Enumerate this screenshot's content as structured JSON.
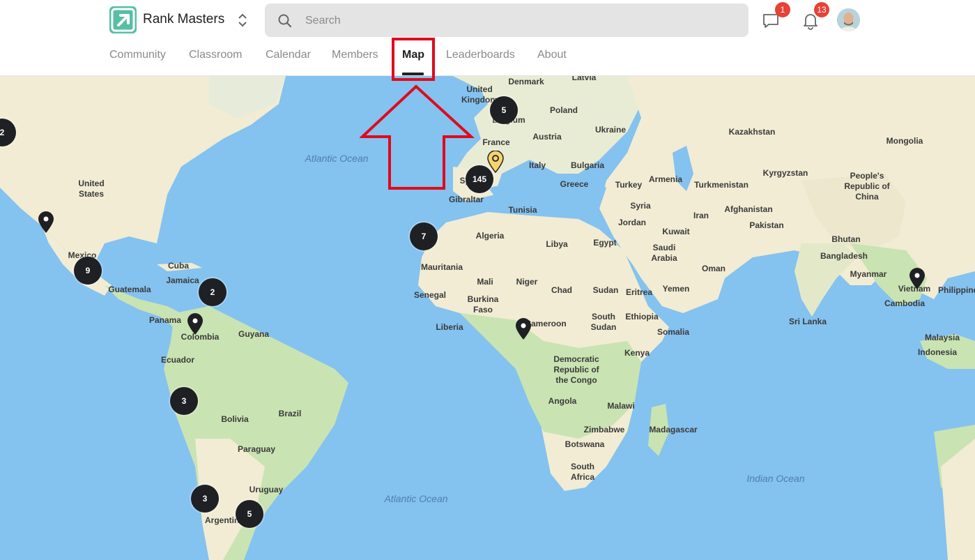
{
  "header": {
    "brand": "Rank Masters",
    "search_placeholder": "Search",
    "chat_badge": "1",
    "notifications_badge": "13"
  },
  "tabs": [
    {
      "label": "Community"
    },
    {
      "label": "Classroom"
    },
    {
      "label": "Calendar"
    },
    {
      "label": "Members"
    },
    {
      "label": "Map"
    },
    {
      "label": "Leaderboards"
    },
    {
      "label": "About"
    }
  ],
  "active_tab": "Map",
  "colors": {
    "accent": "#56bfa6",
    "badge": "#e64235",
    "annotation": "#e00a1d",
    "water": "#84c2f0",
    "land": "#f4efd7",
    "vegetation": "#c8e2b0",
    "cluster": "#1f2023",
    "highlight_pin": "#f6d46d"
  },
  "map": {
    "country_labels": [
      "Latvia",
      "Denmark",
      "United Kingdom",
      "Belgium",
      "Poland",
      "Ukraine",
      "Austria",
      "France",
      "Italy",
      "Bulgaria",
      "Greece",
      "Turkey",
      "Armenia",
      "Kazakhstan",
      "Mongolia",
      "Kyrgyzstan",
      "Turkmenistan",
      "People's Republic of China",
      "Spain",
      "Gibraltar",
      "Tunisia",
      "Syria",
      "Afghanistan",
      "Iran",
      "Pakistan",
      "Jordan",
      "Kuwait",
      "Algeria",
      "Libya",
      "Egypt",
      "Saudi Arabia",
      "Bhutan",
      "Oman",
      "Bangladesh",
      "Mauritania",
      "Mali",
      "Niger",
      "Chad",
      "Sudan",
      "Eritrea",
      "Yemen",
      "Myanmar",
      "Vietnam",
      "Philippines",
      "Senegal",
      "Burkina Faso",
      "South Sudan",
      "Ethiopia",
      "Cambodia",
      "Liberia",
      "Cameroon",
      "Somalia",
      "Sri Lanka",
      "Kenya",
      "Democratic Republic of the Congo",
      "Malaysia",
      "Indonesia",
      "Angola",
      "Malawi",
      "Zimbabwe",
      "Madagascar",
      "Botswana",
      "South Africa",
      "Cuba",
      "Jamaica",
      "Mexico",
      "Guatemala",
      "Panama",
      "Colombia",
      "Guyana",
      "Ecuador",
      "Bolivia",
      "Brazil",
      "Paraguay",
      "Uruguay",
      "Argentina",
      "United States"
    ],
    "ocean_labels": [
      "Atlantic Ocean",
      "Atlantic Ocean",
      "Indian Ocean"
    ],
    "clusters": [
      "2",
      "5",
      "145",
      "7",
      "9",
      "2",
      "3",
      "3",
      "5"
    ],
    "pin_icon": "map-pin-icon"
  }
}
